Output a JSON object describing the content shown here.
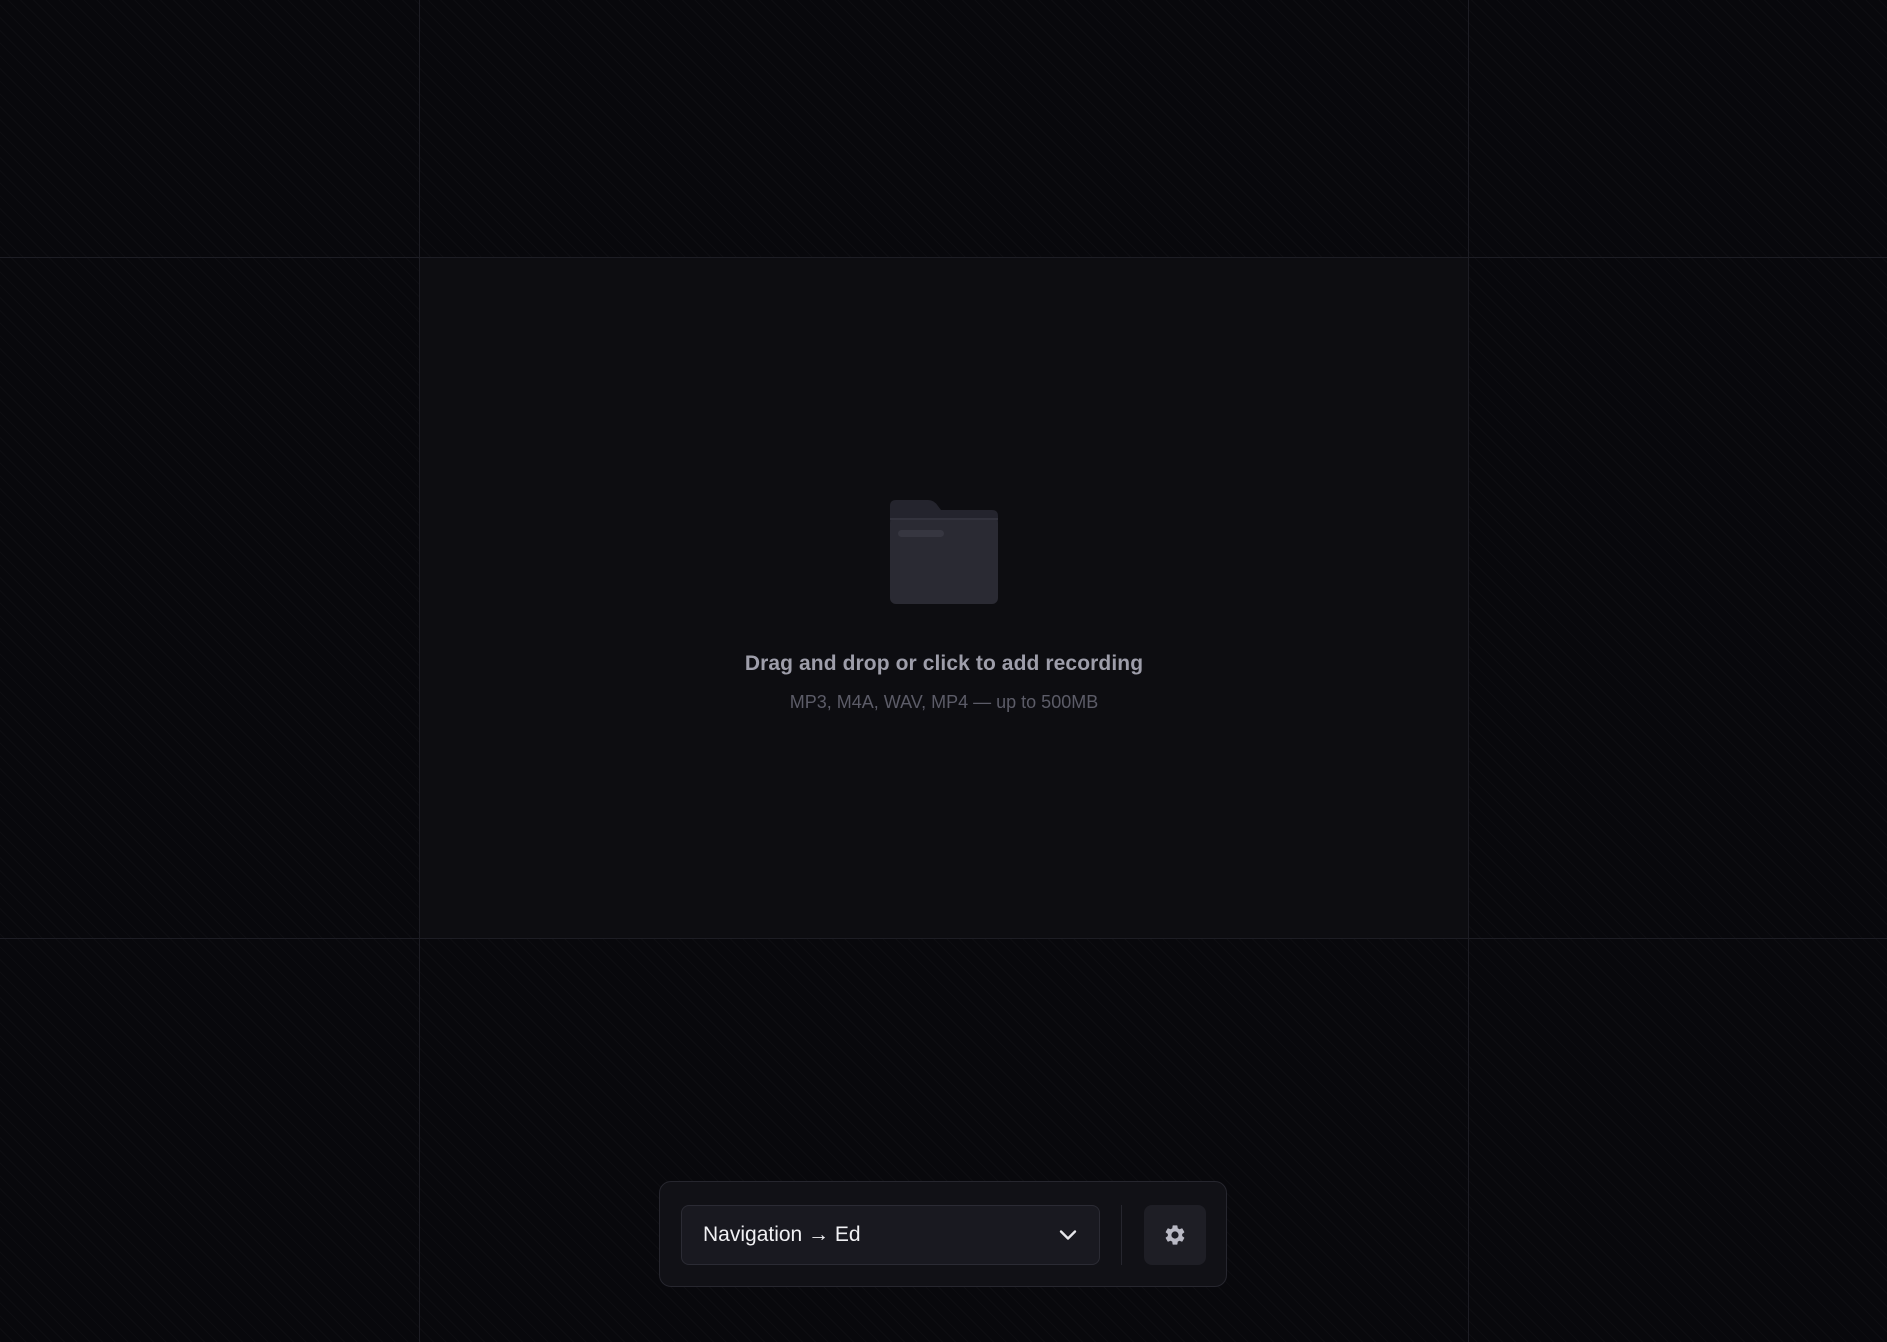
{
  "dropzone": {
    "title": "Drag and drop or click to add recording",
    "subtitle": "MP3, M4A, WAV, MP4 — up to 500MB",
    "icon": "folder-icon"
  },
  "toolbar": {
    "mode_select": {
      "value": "Navigation → Ed",
      "icon": "chevron-down-icon"
    },
    "settings": {
      "icon": "gear-icon"
    }
  },
  "colors": {
    "background": "#08080c",
    "dropzone_bg": "#0d0d11",
    "toolbar_bg": "#111116",
    "text_primary": "#f1f1f4",
    "text_muted": "#9e9eaa",
    "text_dim": "#5c5c68"
  }
}
